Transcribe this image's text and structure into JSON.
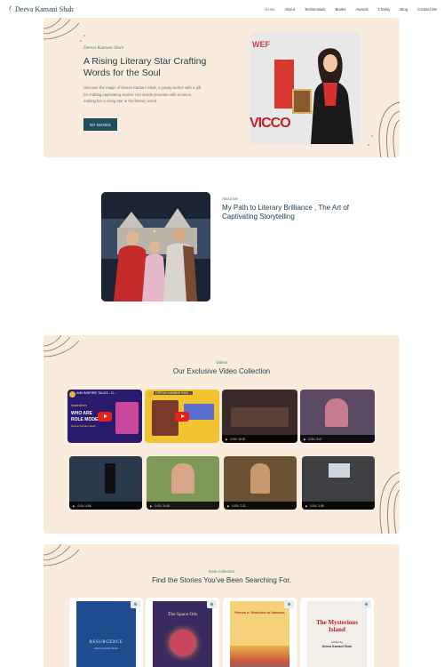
{
  "nav": {
    "logo": "Deeva Kamani Shah",
    "items": [
      {
        "label": "Home",
        "active": true
      },
      {
        "label": "About",
        "active": false
      },
      {
        "label": "Testimonials",
        "active": false
      },
      {
        "label": "Books",
        "active": false
      },
      {
        "label": "Awards",
        "active": false
      },
      {
        "label": "Charity",
        "active": false
      },
      {
        "label": "Blog",
        "active": false
      },
      {
        "label": "Contact Me",
        "active": false
      }
    ]
  },
  "hero": {
    "kicker": "Deeva Kamani Shah",
    "title": "A Rising Literary Star Crafting Words for the Soul",
    "description": "Discover the magic of Deeva Kamani Shah, a young author with a gift for crafting captivating stories. Her words resonate with emotion, making her a rising star in the literary world.",
    "button": "MY BOOKS",
    "photo_text_top": "WEF",
    "photo_text_bottom": "VICCO"
  },
  "about": {
    "kicker": "About Me",
    "title": "My Path to Literary Brilliance , The Art of Captivating Storytelling"
  },
  "videos": {
    "kicker": "Videos",
    "title": "Our Exclusive Video Collection",
    "items": [
      {
        "type": "youtube",
        "title": "AIM INSPIRE TALKS - D..."
      },
      {
        "type": "youtube",
        "title": "DEEVA KAMANI SHA..."
      },
      {
        "type": "player",
        "time": "0:00 / 10:30"
      },
      {
        "type": "player",
        "time": "0:00 / 3:47"
      },
      {
        "type": "player",
        "time": "0:00 / 4:56"
      },
      {
        "type": "player",
        "time": "0:00 / 11:06"
      },
      {
        "type": "player",
        "time": "0:00 / 7:21"
      },
      {
        "type": "player",
        "time": "0:00 / 1:08"
      }
    ],
    "thumb_texts": {
      "v1_line1": "Inspirations",
      "v1_line2": "WHO ARE",
      "v1_line3": "ROLE MODEL",
      "v1_line4": "Deeva Kamani Shah"
    }
  },
  "books": {
    "kicker": "Book Collection",
    "title": "Find the Stories You've Been Searching For.",
    "covers": [
      {
        "title": "RESURGENCE",
        "author": "DEEVA KAMANI SHAH"
      },
      {
        "title": "The Space Orb",
        "author": ""
      },
      {
        "title": "Pieces o' Rainbow to Vanaras",
        "author": ""
      },
      {
        "title": "The Mysterious Island",
        "author": "Deeva Kamani Shah",
        "byline": "written by"
      }
    ]
  },
  "colors": {
    "accent_green": "#3f8a4f",
    "navy": "#1d3b4b",
    "section_bg": "#faecdc",
    "button": "#1d4f5f"
  }
}
